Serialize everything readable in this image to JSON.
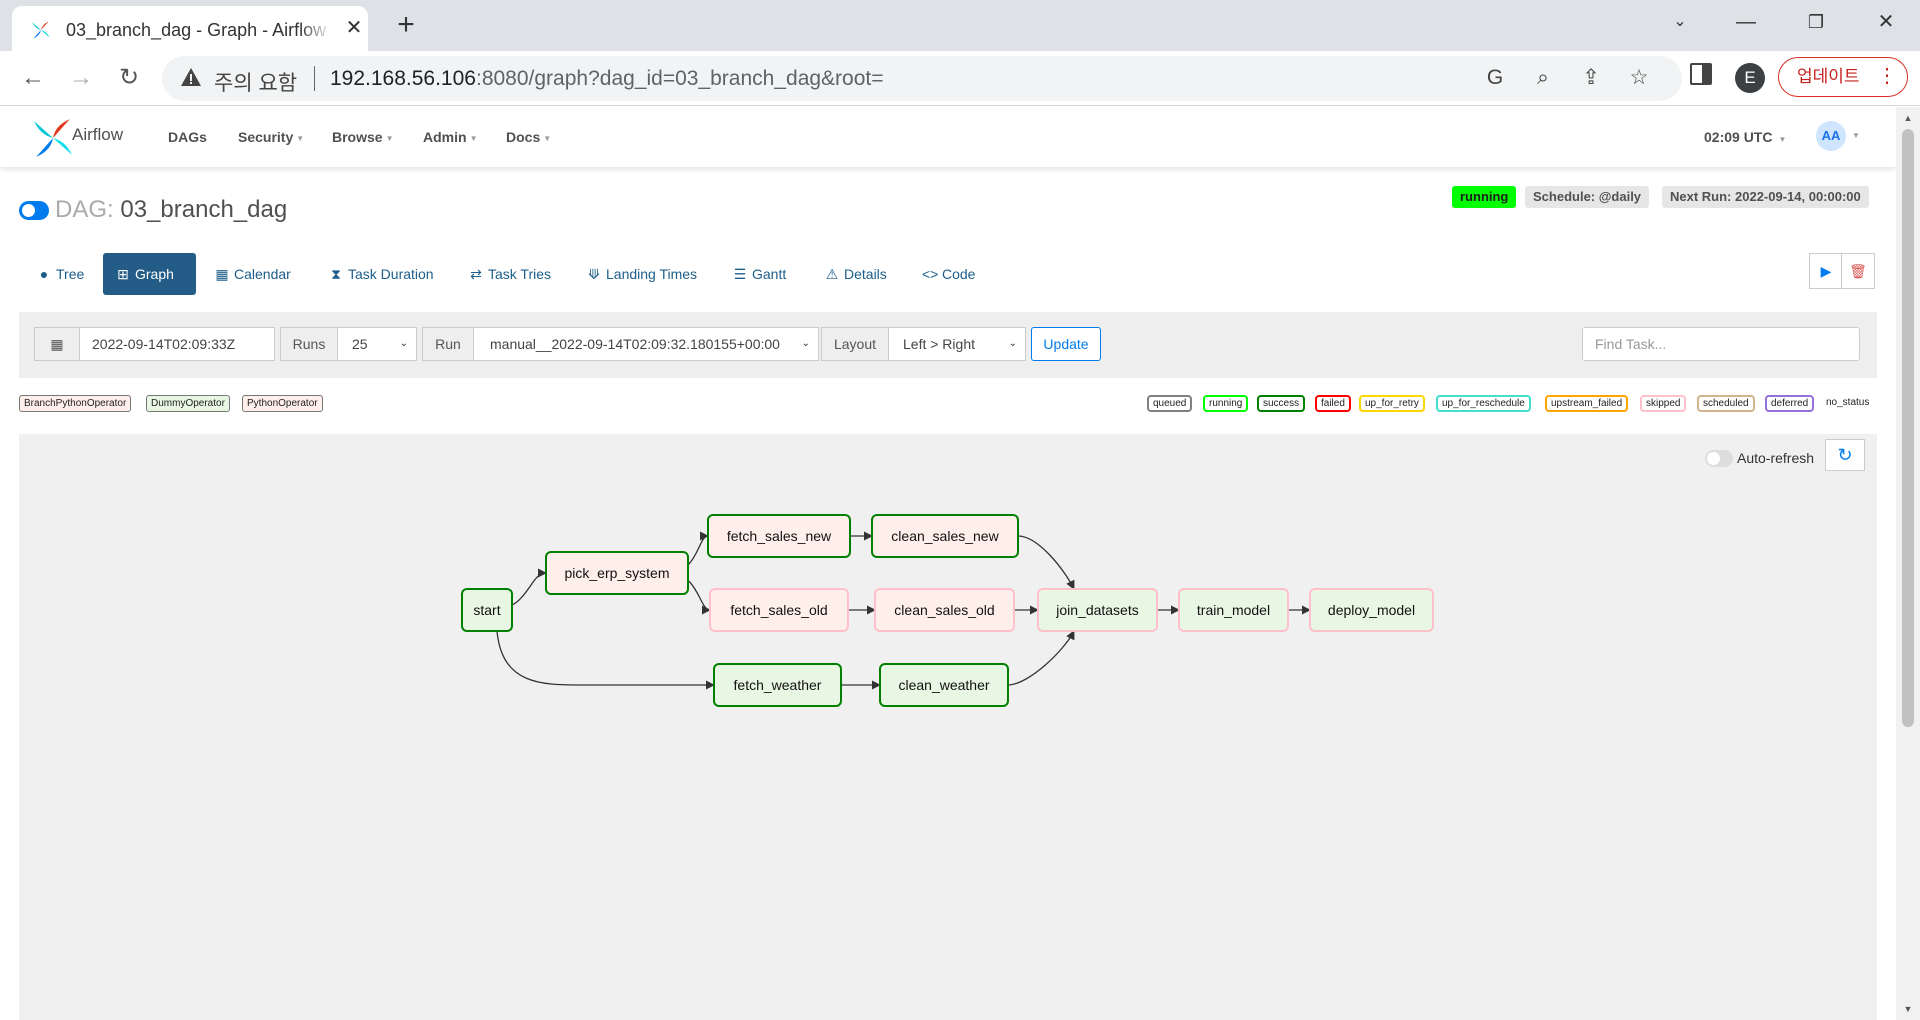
{
  "browser": {
    "tab_title": "03_branch_dag - Graph - Airflow",
    "newtab_symbol": "+",
    "security_label": "주의 요함",
    "url_host": "192.168.56.106",
    "url_rest": ":8080/graph?dag_id=03_branch_dag&root=",
    "profile_initial": "E",
    "update_label": "업데이트"
  },
  "navbar": {
    "brand": "Airflow",
    "menu": [
      "DAGs",
      "Security",
      "Browse",
      "Admin",
      "Docs"
    ],
    "time": "02:09 UTC",
    "avatar": "AA"
  },
  "header": {
    "dag_label": "DAG:",
    "dag_id": "03_branch_dag",
    "state": "running",
    "schedule": "Schedule: @daily",
    "next_run": "Next Run: 2022-09-14, 00:00:00"
  },
  "tabs": [
    "Tree",
    "Graph",
    "Calendar",
    "Task Duration",
    "Task Tries",
    "Landing Times",
    "Gantt",
    "Details",
    "Code"
  ],
  "filters": {
    "base_date": "2022-09-14T02:09:33Z",
    "runs_label": "Runs",
    "runs_value": "25",
    "run_label": "Run",
    "run_value": "manual__2022-09-14T02:09:32.180155+00:00",
    "layout_label": "Layout",
    "layout_value": "Left > Right",
    "update_label": "Update",
    "find_placeholder": "Find Task..."
  },
  "operators": [
    {
      "name": "BranchPythonOperator",
      "color": "#ffefeb"
    },
    {
      "name": "DummyOperator",
      "color": "#e8f7e4"
    },
    {
      "name": "PythonOperator",
      "color": "#ffefeb"
    }
  ],
  "states": [
    {
      "name": "queued",
      "color": "#808080"
    },
    {
      "name": "running",
      "color": "#00ff00"
    },
    {
      "name": "success",
      "color": "#008000"
    },
    {
      "name": "failed",
      "color": "#ff0000"
    },
    {
      "name": "up_for_retry",
      "color": "#ffd700"
    },
    {
      "name": "up_for_reschedule",
      "color": "#40e0d0"
    },
    {
      "name": "upstream_failed",
      "color": "#ffa500"
    },
    {
      "name": "skipped",
      "color": "#ffc0cb"
    },
    {
      "name": "scheduled",
      "color": "#d2b48c"
    },
    {
      "name": "deferred",
      "color": "#9370db"
    },
    {
      "name": "no_status",
      "color": "#ffffff"
    }
  ],
  "graph": {
    "autorefresh_label": "Auto-refresh",
    "tasks": [
      {
        "id": "start",
        "operator": "DummyOperator",
        "state": "success"
      },
      {
        "id": "pick_erp_system",
        "operator": "BranchPythonOperator",
        "state": "success"
      },
      {
        "id": "fetch_sales_new",
        "operator": "PythonOperator",
        "state": "success"
      },
      {
        "id": "clean_sales_new",
        "operator": "PythonOperator",
        "state": "success"
      },
      {
        "id": "fetch_sales_old",
        "operator": "PythonOperator",
        "state": "skipped"
      },
      {
        "id": "clean_sales_old",
        "operator": "PythonOperator",
        "state": "skipped"
      },
      {
        "id": "fetch_weather",
        "operator": "DummyOperator",
        "state": "success"
      },
      {
        "id": "clean_weather",
        "operator": "DummyOperator",
        "state": "success"
      },
      {
        "id": "join_datasets",
        "operator": "DummyOperator",
        "state": "skipped"
      },
      {
        "id": "train_model",
        "operator": "DummyOperator",
        "state": "skipped"
      },
      {
        "id": "deploy_model",
        "operator": "DummyOperator",
        "state": "skipped"
      }
    ]
  }
}
